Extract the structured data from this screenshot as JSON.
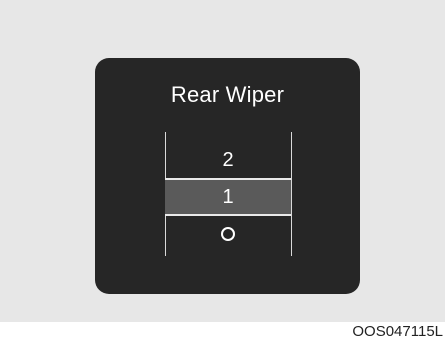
{
  "panel": {
    "title": "Rear Wiper",
    "positions": [
      "2",
      "1",
      "O"
    ],
    "selected": "1"
  },
  "figure_code": "OOS047115L",
  "colors": {
    "panel_background": "#262626",
    "selected_band": "#5a5a5a",
    "frame_background": "#e7e7e7"
  },
  "icons": {
    "off_position": "circle-off-icon"
  }
}
